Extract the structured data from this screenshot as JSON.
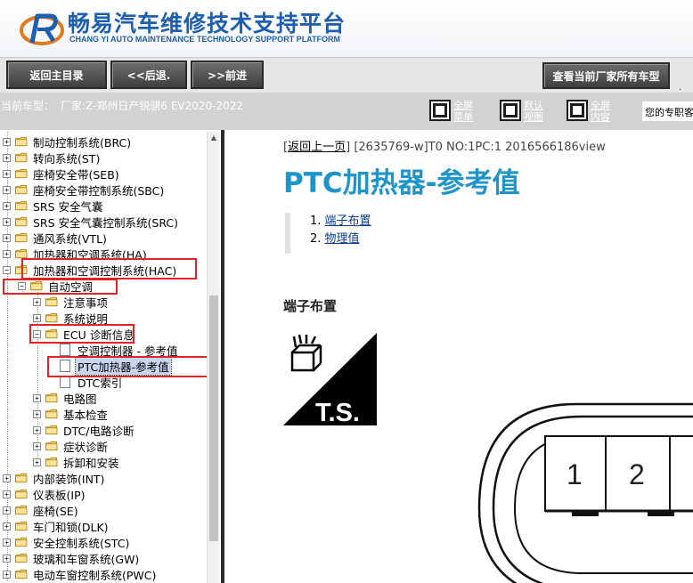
{
  "header": {
    "brand_title": "畅易汽车维修技术支持平台",
    "brand_subtitle": "CHANG YI AUTO MAINTENANCE TECHNOLOGY SUPPORT PLATFORM",
    "accent_color": "#1d5fae"
  },
  "toolbar": {
    "back_main": "返回主目录",
    "prev": "<<后退.",
    "next": ">>前进",
    "view_all_models": "查看当前厂家所有车型",
    "trailing_mark": "."
  },
  "vehicle_bar": {
    "label": "当前车型：",
    "value": "厂家:Z-郑州日产锐骐6 EV2020-2022",
    "fullscreen_menu": "全屏菜单",
    "default_view": "默认视图",
    "fullscreen_content": "全屏内容",
    "notice": "您的专职客服"
  },
  "tree": [
    {
      "label": "制动控制系统(BRC)",
      "pm": "+",
      "type": "folder"
    },
    {
      "label": "转向系统(ST)",
      "pm": "+",
      "type": "folder"
    },
    {
      "label": "座椅安全带(SEB)",
      "pm": "+",
      "type": "folder"
    },
    {
      "label": "座椅安全带控制系统(SBC)",
      "pm": "+",
      "type": "folder"
    },
    {
      "label": "SRS 安全气囊",
      "pm": "+",
      "type": "folder"
    },
    {
      "label": "SRS 安全气囊控制系统(SRC)",
      "pm": "+",
      "type": "folder"
    },
    {
      "label": "通风系统(VTL)",
      "pm": "+",
      "type": "folder"
    },
    {
      "label": "加热器和空调系统(HA)",
      "pm": "+",
      "type": "folder"
    },
    {
      "label": "加热器和空调控制系统(HAC)",
      "pm": "−",
      "type": "folder"
    },
    {
      "label": "自动空调",
      "pm": "−",
      "type": "folder"
    },
    {
      "label": "注意事项",
      "pm": "+",
      "type": "folder"
    },
    {
      "label": "系统说明",
      "pm": "+",
      "type": "folder"
    },
    {
      "label": "ECU 诊断信息",
      "pm": "−",
      "type": "folder"
    },
    {
      "label": "空调控制器 - 参考值",
      "pm": "",
      "type": "doc"
    },
    {
      "label": "PTC加热器-参考值",
      "pm": "",
      "type": "doc"
    },
    {
      "label": "DTC索引",
      "pm": "",
      "type": "doc"
    },
    {
      "label": "电路图",
      "pm": "+",
      "type": "folder"
    },
    {
      "label": "基本检查",
      "pm": "+",
      "type": "folder"
    },
    {
      "label": "DTC/电路诊断",
      "pm": "+",
      "type": "folder"
    },
    {
      "label": "症状诊断",
      "pm": "+",
      "type": "folder"
    },
    {
      "label": "拆卸和安装",
      "pm": "+",
      "type": "folder"
    },
    {
      "label": "内部装饰(INT)",
      "pm": "+",
      "type": "folder"
    },
    {
      "label": "仪表板(IP)",
      "pm": "+",
      "type": "folder"
    },
    {
      "label": "座椅(SE)",
      "pm": "+",
      "type": "folder"
    },
    {
      "label": "车门和锁(DLK)",
      "pm": "+",
      "type": "folder"
    },
    {
      "label": "安全控制系统(STC)",
      "pm": "+",
      "type": "folder"
    },
    {
      "label": "玻璃和车窗系统(GW)",
      "pm": "+",
      "type": "folder"
    },
    {
      "label": "电动车窗控制系统(PWC)",
      "pm": "+",
      "type": "folder"
    }
  ],
  "content": {
    "back_link": "返回上一页",
    "doc_code": "[2635769-w]T0 NO:1PC:1 2016566186view",
    "title": "PTC加热器-参考值",
    "toc": [
      {
        "num": "1.",
        "label": "端子布置"
      },
      {
        "num": "2.",
        "label": "物理值"
      }
    ],
    "section_heading": "端子布置",
    "ts_label": "T.S.",
    "pins": [
      "1",
      "2"
    ],
    "title_color": "#1f94c9"
  },
  "icons": {
    "logo": "chang-yi-logo",
    "view_buttons": "window-layout-icon",
    "folders": "folder-icon",
    "documents": "document-icon"
  }
}
